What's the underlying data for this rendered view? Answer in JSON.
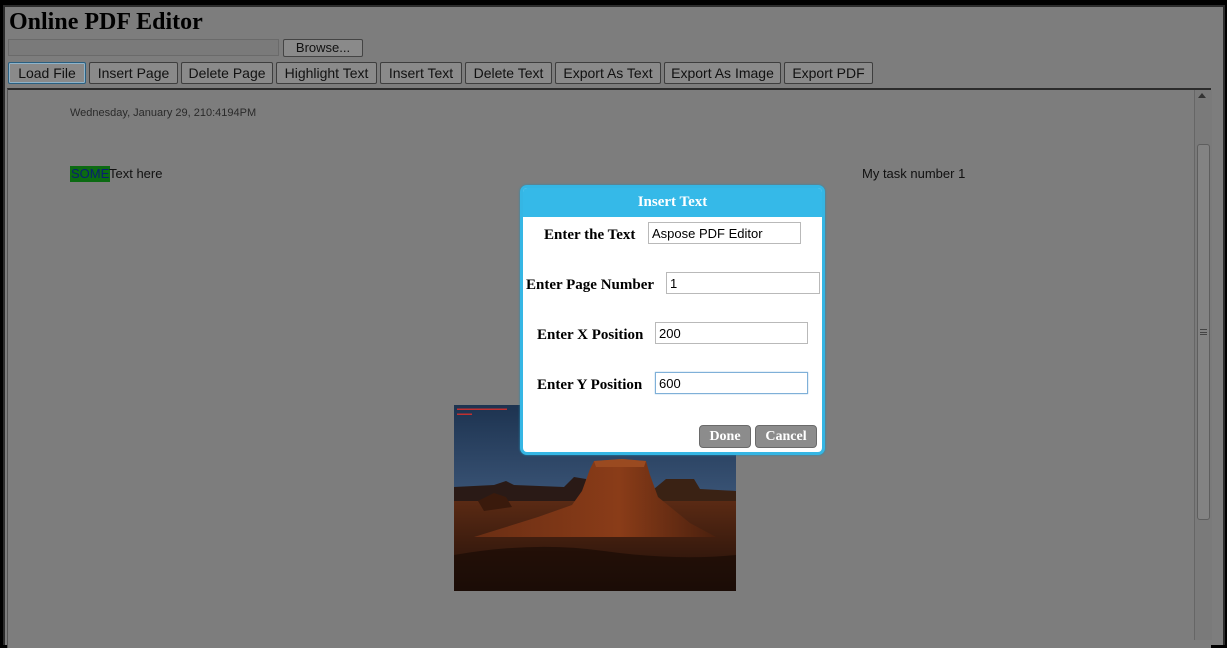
{
  "app": {
    "title": "Online PDF Editor",
    "browse_label": "Browse..."
  },
  "toolbar": {
    "buttons": [
      {
        "label": "Load File",
        "active": true
      },
      {
        "label": "Insert Page"
      },
      {
        "label": "Delete Page"
      },
      {
        "label": "Highlight Text"
      },
      {
        "label": "Insert Text"
      },
      {
        "label": "Delete Text"
      },
      {
        "label": "Export As Text"
      },
      {
        "label": "Export As Image"
      },
      {
        "label": "Export PDF"
      }
    ]
  },
  "document": {
    "timestamp": "Wednesday, January 29, 210:4194PM",
    "highlighted_word": "SOME",
    "text_after_highlight": "Text here",
    "right_text": "My task number 1",
    "image": {
      "description": "desert-butte-photo",
      "caption_lines": 2
    }
  },
  "dialog": {
    "title": "Insert Text",
    "fields": [
      {
        "label": "Enter the Text",
        "value": "Aspose PDF Editor"
      },
      {
        "label": "Enter Page Number",
        "value": "1"
      },
      {
        "label": "Enter X Position",
        "value": "200"
      },
      {
        "label": "Enter Y Position",
        "value": "600"
      }
    ],
    "done_label": "Done",
    "cancel_label": "Cancel"
  },
  "colors": {
    "overlay_bg": "#7d7d7d",
    "dialog_accent": "#35b9e8",
    "highlight": "#0b6a12"
  },
  "icons": {
    "scroll_up": "triangle-up",
    "scroll_grip": "three-lines"
  }
}
